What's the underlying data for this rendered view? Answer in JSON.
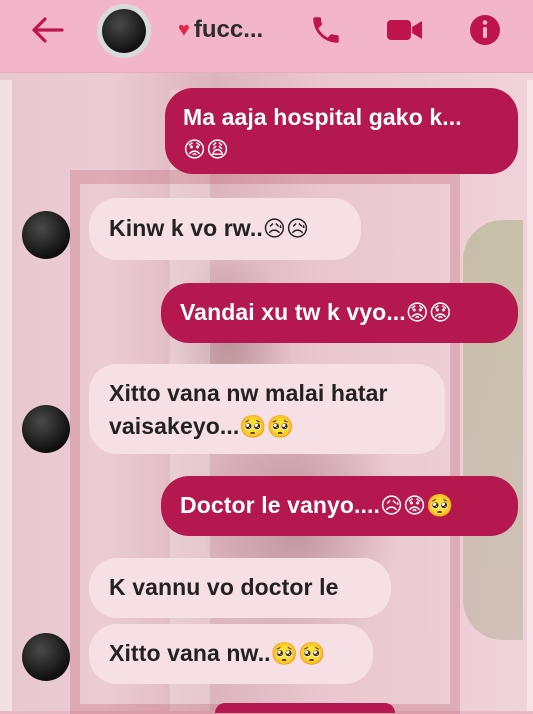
{
  "header": {
    "contact_name": "fucc...",
    "heart": "♥"
  },
  "messages": [
    {
      "id": "m1",
      "side": "out",
      "text": "Ma aaja hospital gako k...",
      "emoji": "😟😩"
    },
    {
      "id": "m2",
      "side": "in",
      "text": "Kinw k vo rw..",
      "emoji": "😥😥"
    },
    {
      "id": "m3",
      "side": "out",
      "text": "Vandai xu tw k vyo...",
      "emoji": "😟😟"
    },
    {
      "id": "m4",
      "side": "in",
      "text": "Xitto vana nw malai hatar",
      "text2": "vaisakeyo...",
      "emoji": "🥺🥺"
    },
    {
      "id": "m5",
      "side": "out",
      "text": "Doctor le vanyo....",
      "emoji": "😥😟🥺"
    },
    {
      "id": "m6",
      "side": "in",
      "text": "K vannu vo doctor le"
    },
    {
      "id": "m7",
      "side": "in",
      "text": "Xitto vana nw..",
      "emoji": "🥺🥺"
    }
  ],
  "colors": {
    "outgoing_bubble": "#b5174f",
    "incoming_bubble": "#f7dfe6",
    "header_bg": "#f3b5c9",
    "icon_accent": "#c0144d"
  },
  "icons": [
    "back-arrow-icon",
    "phone-icon",
    "video-camera-icon",
    "info-icon",
    "heart-icon"
  ]
}
